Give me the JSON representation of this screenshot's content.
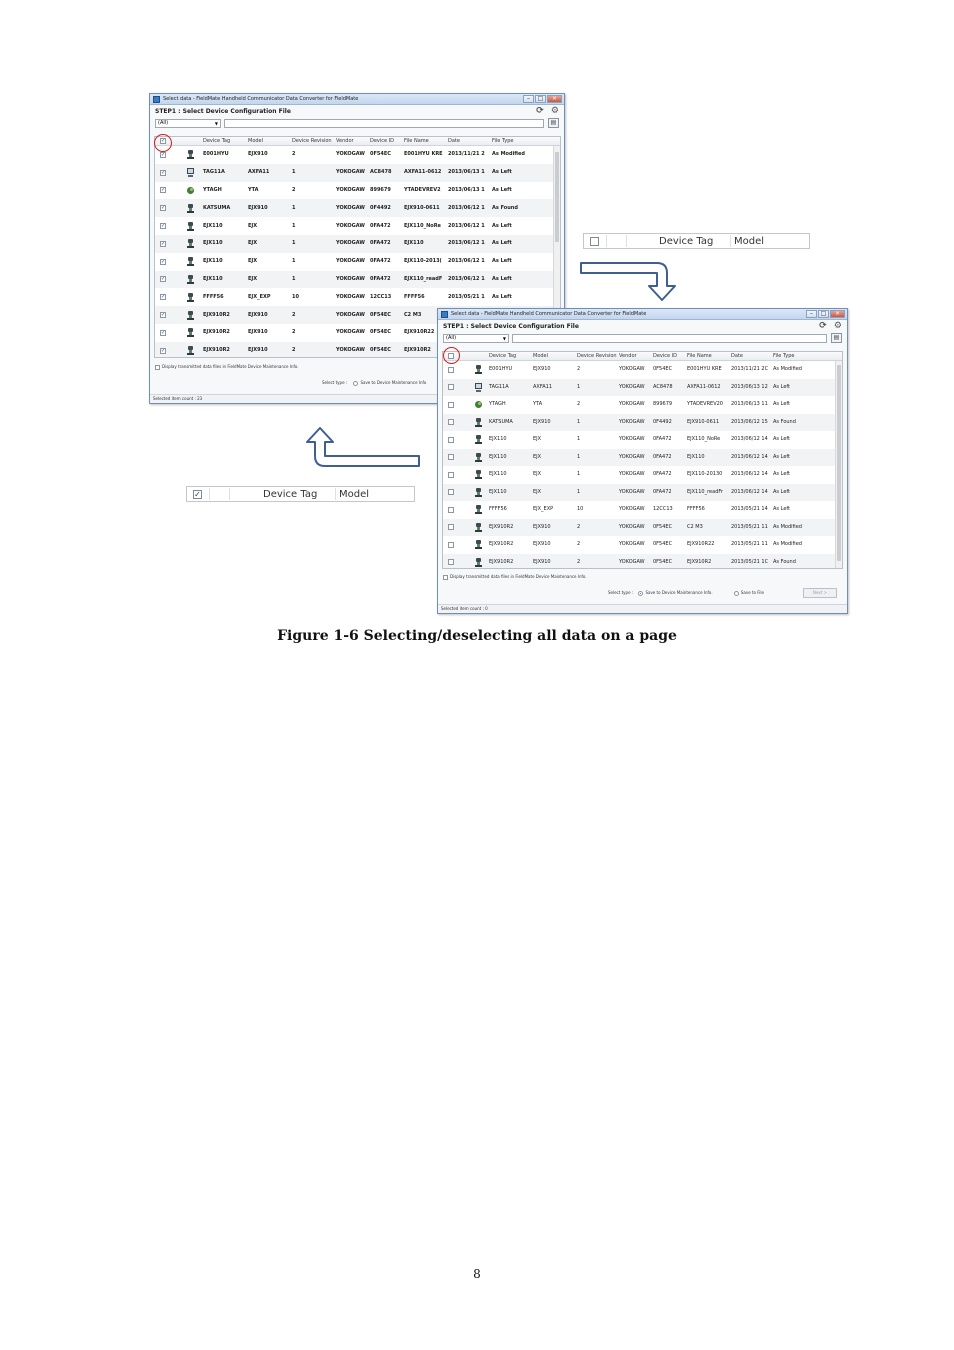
{
  "window_title": "Select data - FieldMate Handheld Communicator Data Converter for FieldMate",
  "step_title": "STEP1 : Select Device Configuration File",
  "filter_value": "(All)",
  "columns": [
    "Device Tag",
    "Model",
    "Device Revision",
    "Vendor",
    "Device ID",
    "File Name",
    "Date",
    "File Type"
  ],
  "window1": {
    "rows": [
      {
        "tag": "E001HYU",
        "model": "EJX910",
        "rev": "2",
        "vendor": "YOKOGAW",
        "id": "0F54EC",
        "file": "E001HYU KRE",
        "date": "2013/11/21 2",
        "type": "As Modified",
        "icon": "device"
      },
      {
        "tag": "TAG11A",
        "model": "AXFA11",
        "rev": "1",
        "vendor": "YOKOGAW",
        "id": "AC8478",
        "file": "AXFA11-0612",
        "date": "2013/06/13 1",
        "type": "As Left",
        "icon": "monitor"
      },
      {
        "tag": "YTAGH",
        "model": "YTA",
        "rev": "2",
        "vendor": "YOKOGAW",
        "id": "899679",
        "file": "YTADEVREV2",
        "date": "2013/06/13 1",
        "type": "As Left",
        "icon": "globe"
      },
      {
        "tag": "KATSUMA",
        "model": "EJX910",
        "rev": "1",
        "vendor": "YOKOGAW",
        "id": "0F4492",
        "file": "EJX910-0611",
        "date": "2013/06/12 1",
        "type": "As Found",
        "icon": "device"
      },
      {
        "tag": "EJX110",
        "model": "EJX",
        "rev": "1",
        "vendor": "YOKOGAW",
        "id": "0FA472",
        "file": "EJX110_NoRe",
        "date": "2013/06/12 1",
        "type": "As Left",
        "icon": "device"
      },
      {
        "tag": "EJX110",
        "model": "EJX",
        "rev": "1",
        "vendor": "YOKOGAW",
        "id": "0FA472",
        "file": "EJX110",
        "date": "2013/06/12 1",
        "type": "As Left",
        "icon": "device"
      },
      {
        "tag": "EJX110",
        "model": "EJX",
        "rev": "1",
        "vendor": "YOKOGAW",
        "id": "0FA472",
        "file": "EJX110-2013(",
        "date": "2013/06/12 1",
        "type": "As Left",
        "icon": "device"
      },
      {
        "tag": "EJX110",
        "model": "EJX",
        "rev": "1",
        "vendor": "YOKOGAW",
        "id": "0FA472",
        "file": "EJX110_readF",
        "date": "2013/06/12 1",
        "type": "As Left",
        "icon": "device"
      },
      {
        "tag": "FFFF56",
        "model": "EJX_EXP",
        "rev": "10",
        "vendor": "YOKOGAW",
        "id": "12CC13",
        "file": "FFFF56",
        "date": "2013/05/21 1",
        "type": "As Left",
        "icon": "device"
      },
      {
        "tag": "EJX910R2",
        "model": "EJX910",
        "rev": "2",
        "vendor": "YOKOGAW",
        "id": "0F54EC",
        "file": "C2 M3",
        "date": "",
        "type": "",
        "icon": "device"
      },
      {
        "tag": "EJX910R2",
        "model": "EJX910",
        "rev": "2",
        "vendor": "YOKOGAW",
        "id": "0F54EC",
        "file": "EJX910R22",
        "date": "",
        "type": "",
        "icon": "device"
      },
      {
        "tag": "EJX910R2",
        "model": "EJX910",
        "rev": "2",
        "vendor": "YOKOGAW",
        "id": "0F54EC",
        "file": "EJX910R2",
        "date": "",
        "type": "",
        "icon": "device"
      }
    ],
    "display_option": "Display transmitted data files in FieldMate Device Maintenance Info.",
    "select_type_label": "Select type :",
    "radio_label": "Save to Device Maintenance Info",
    "status": "Selected item count : 23"
  },
  "window2": {
    "rows": [
      {
        "tag": "E001HYU",
        "model": "EJX910",
        "rev": "2",
        "vendor": "YOKOGAW",
        "id": "0F54EC",
        "file": "E001HYU KRE",
        "date": "2013/11/21 2C",
        "type": "As Modified",
        "icon": "device"
      },
      {
        "tag": "TAG11A",
        "model": "AXFA11",
        "rev": "1",
        "vendor": "YOKOGAW",
        "id": "AC8478",
        "file": "AXFA11-0612",
        "date": "2013/06/13 12",
        "type": "As Left",
        "icon": "monitor"
      },
      {
        "tag": "YTAGH",
        "model": "YTA",
        "rev": "2",
        "vendor": "YOKOGAW",
        "id": "899679",
        "file": "YTADEVREV20",
        "date": "2013/06/13 11",
        "type": "As Left",
        "icon": "globe"
      },
      {
        "tag": "KATSUMA",
        "model": "EJX910",
        "rev": "1",
        "vendor": "YOKOGAW",
        "id": "0F4492",
        "file": "EJX910-0611",
        "date": "2013/06/12 15",
        "type": "As Found",
        "icon": "device"
      },
      {
        "tag": "EJX110",
        "model": "EJX",
        "rev": "1",
        "vendor": "YOKOGAW",
        "id": "0FA472",
        "file": "EJX110_NoRe",
        "date": "2013/06/12 14",
        "type": "As Left",
        "icon": "device"
      },
      {
        "tag": "EJX110",
        "model": "EJX",
        "rev": "1",
        "vendor": "YOKOGAW",
        "id": "0FA472",
        "file": "EJX110",
        "date": "2013/06/12 14",
        "type": "As Left",
        "icon": "device"
      },
      {
        "tag": "EJX110",
        "model": "EJX",
        "rev": "1",
        "vendor": "YOKOGAW",
        "id": "0FA472",
        "file": "EJX110-20130",
        "date": "2013/06/12 14",
        "type": "As Left",
        "icon": "device"
      },
      {
        "tag": "EJX110",
        "model": "EJX",
        "rev": "1",
        "vendor": "YOKOGAW",
        "id": "0FA472",
        "file": "EJX110_readFr",
        "date": "2013/06/12 14",
        "type": "As Left",
        "icon": "device"
      },
      {
        "tag": "FFFF56",
        "model": "EJX_EXP",
        "rev": "10",
        "vendor": "YOKOGAW",
        "id": "12CC13",
        "file": "FFFF56",
        "date": "2013/05/21 14",
        "type": "As Left",
        "icon": "device"
      },
      {
        "tag": "EJX910R2",
        "model": "EJX910",
        "rev": "2",
        "vendor": "YOKOGAW",
        "id": "0F54EC",
        "file": "C2 M3",
        "date": "2013/05/21 11",
        "type": "As Modified",
        "icon": "device"
      },
      {
        "tag": "EJX910R2",
        "model": "EJX910",
        "rev": "2",
        "vendor": "YOKOGAW",
        "id": "0F54EC",
        "file": "EJX910R22",
        "date": "2013/05/21 11",
        "type": "As Modified",
        "icon": "device"
      },
      {
        "tag": "EJX910R2",
        "model": "EJX910",
        "rev": "2",
        "vendor": "YOKOGAW",
        "id": "0F54EC",
        "file": "EJX910R2",
        "date": "2013/05/21 1C",
        "type": "As Found",
        "icon": "device"
      }
    ],
    "display_option": "Display transmitted data files in FieldMate Device Maintenance Info.",
    "select_type_label": "Select type :",
    "radio_device_label": "Save to Device Maintenance Info.",
    "radio_file_label": "Save to File",
    "next_label": "Next >",
    "status": "Selected item count : 0"
  },
  "callout_unchecked": {
    "device_tag": "Device Tag",
    "model": "Model"
  },
  "callout_checked": {
    "device_tag": "Device Tag",
    "model": "Model"
  },
  "caption": "Figure 1-6 Selecting/deselecting all data on a page",
  "page_number": "8",
  "colors": {
    "highlight_ring": "#d71c1c",
    "arrow": "#3f5f90",
    "window_border": "#6d8fb8"
  }
}
